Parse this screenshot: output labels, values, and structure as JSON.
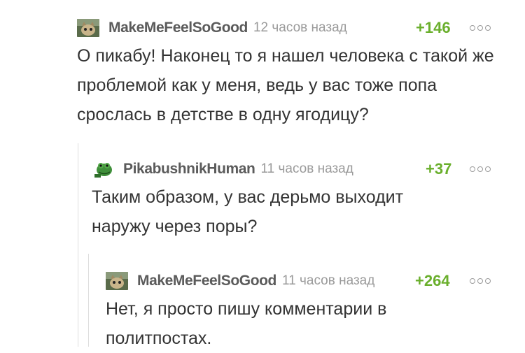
{
  "comments": [
    {
      "author": "MakeMeFeelSoGood",
      "time": "12 часов назад",
      "rating": "+146",
      "text": "О пикабу! Наконец то я нашел человека с такой же проблемой как у меня, ведь у вас тоже попа срослась в детстве в одну ягодицу?",
      "avatar": "cat-avatar-icon"
    },
    {
      "author": "PikabushnikHuman",
      "time": "11 часов назад",
      "rating": "+37",
      "text": "Таким образом, у вас дерьмо выходит наружу через поры?",
      "avatar": "frog-avatar-icon"
    },
    {
      "author": "MakeMeFeelSoGood",
      "time": "11 часов назад",
      "rating": "+264",
      "text": "Нет, я просто пишу комментарии в политпостах.",
      "avatar": "cat-avatar-icon"
    }
  ],
  "colors": {
    "rating": "#6aaf2c",
    "author": "#5b5b5b",
    "time": "#9a9a9a",
    "text": "#333333"
  }
}
